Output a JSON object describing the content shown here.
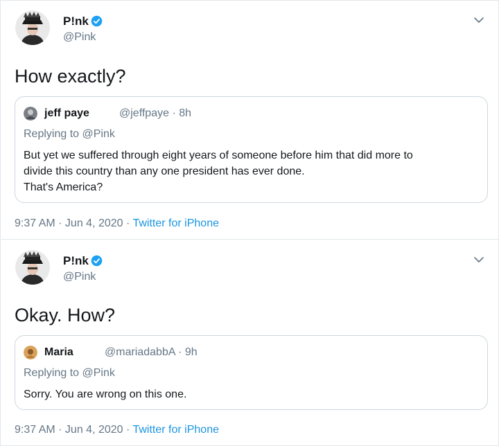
{
  "colors": {
    "text": "#14171a",
    "secondary": "#657786",
    "link": "#1b95e0",
    "verified": "#1da1f2",
    "border": "#e1e8ed"
  },
  "tweets": [
    {
      "author": {
        "name": "P!nk",
        "handle": "@Pink",
        "verified": true,
        "avatar_icon": "pink-avatar-icon"
      },
      "text": "How exactly?",
      "quote": {
        "author": {
          "name": "jeff paye",
          "handle": "@jeffpaye",
          "time": "8h",
          "avatar_icon": "jeff-avatar-icon"
        },
        "replying_prefix": "Replying to",
        "replying_to": "@Pink",
        "text": "But yet we suffered through eight years of someone before him that did more to\ndivide this country than any one president has ever done.\nThat's America?"
      },
      "timestamp": "9:37 AM · Jun 4, 2020",
      "separator": "·",
      "source": "Twitter for iPhone"
    },
    {
      "author": {
        "name": "P!nk",
        "handle": "@Pink",
        "verified": true,
        "avatar_icon": "pink-avatar-icon"
      },
      "text": "Okay. How?",
      "quote": {
        "author": {
          "name": "Maria",
          "handle": "@mariadabbA",
          "time": "9h",
          "avatar_icon": "maria-avatar-icon"
        },
        "replying_prefix": "Replying to",
        "replying_to": "@Pink",
        "text": "Sorry. You are wrong on this one."
      },
      "timestamp": "9:37 AM · Jun 4, 2020",
      "separator": "·",
      "source": "Twitter for iPhone"
    }
  ]
}
